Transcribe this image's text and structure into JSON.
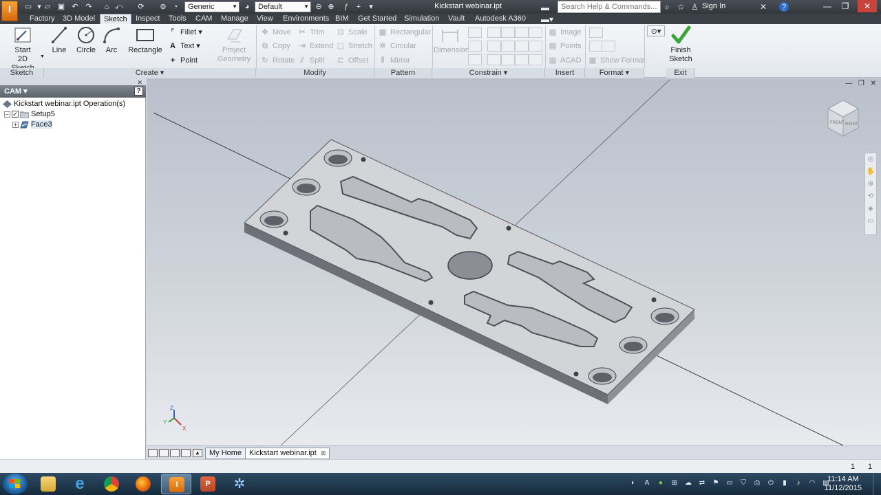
{
  "title_bar": {
    "document_title": "Kickstart webinar.ipt",
    "material_combo": "Generic",
    "appearance_combo": "Default",
    "search_placeholder": "Search Help & Commands...",
    "sign_in": "Sign In",
    "app_logo": "I"
  },
  "ribbon_tabs": [
    "Factory",
    "3D Model",
    "Sketch",
    "Inspect",
    "Tools",
    "CAM",
    "Manage",
    "View",
    "Environments",
    "BIM",
    "Get Started",
    "Simulation",
    "Vault",
    "Autodesk A360"
  ],
  "active_tab": "Sketch",
  "ribbon": {
    "sketch_panel": {
      "start_sketch_line1": "Start",
      "start_sketch_line2": "2D Sketch",
      "label": "Sketch"
    },
    "create_panel": {
      "line": "Line",
      "circle": "Circle",
      "arc": "Arc",
      "rectangle": "Rectangle",
      "fillet": "Fillet",
      "text": "Text",
      "point": "Point",
      "project_geometry_line1": "Project",
      "project_geometry_line2": "Geometry",
      "label": "Create"
    },
    "modify_panel": {
      "move": "Move",
      "trim": "Trim",
      "scale": "Scale",
      "copy": "Copy",
      "extend": "Extend",
      "stretch": "Stretch",
      "rotate": "Rotate",
      "split": "Split",
      "offset": "Offset",
      "label": "Modify"
    },
    "pattern_panel": {
      "rectangular": "Rectangular",
      "circular": "Circular",
      "mirror": "Mirror",
      "label": "Pattern"
    },
    "constrain_panel": {
      "dimension": "Dimension",
      "label": "Constrain"
    },
    "insert_panel": {
      "image": "Image",
      "points": "Points",
      "acad": "ACAD",
      "label": "Insert"
    },
    "format_panel": {
      "show_format": "Show Format",
      "label": "Format"
    },
    "exit_panel": {
      "finish_line1": "Finish",
      "finish_line2": "Sketch",
      "label": "Exit"
    }
  },
  "browser": {
    "header": "CAM",
    "help": "?",
    "tree": [
      {
        "label": "Kickstart webinar.ipt Operation(s)"
      },
      {
        "label": "Setup5",
        "checked": "✓"
      },
      {
        "label": "Face3"
      }
    ]
  },
  "viewport": {
    "viewcube_front": "FRONT",
    "viewcube_right": "RIGHT",
    "axis_z": "Z",
    "axis_x": "X",
    "axis_y": "Y"
  },
  "doc_tabs": [
    {
      "label": "My Home"
    },
    {
      "label": "Kickstart webinar.ipt",
      "close": "⊠"
    }
  ],
  "status_bar": {
    "value_left": "1",
    "value_right": "1"
  },
  "taskbar": {
    "time": "11:14 AM",
    "date": "11/12/2015",
    "pinned_apps": [
      "file-explorer",
      "internet-explorer",
      "chrome",
      "firefox",
      "inventor",
      "powerpoint",
      "snowflake-app"
    ]
  },
  "colors": {
    "accent_green": "#3aa53a",
    "active_tab_bg": "#e9edf2",
    "title_bar_bg": "#3c4047",
    "taskbar_bg": "#1e3850"
  }
}
